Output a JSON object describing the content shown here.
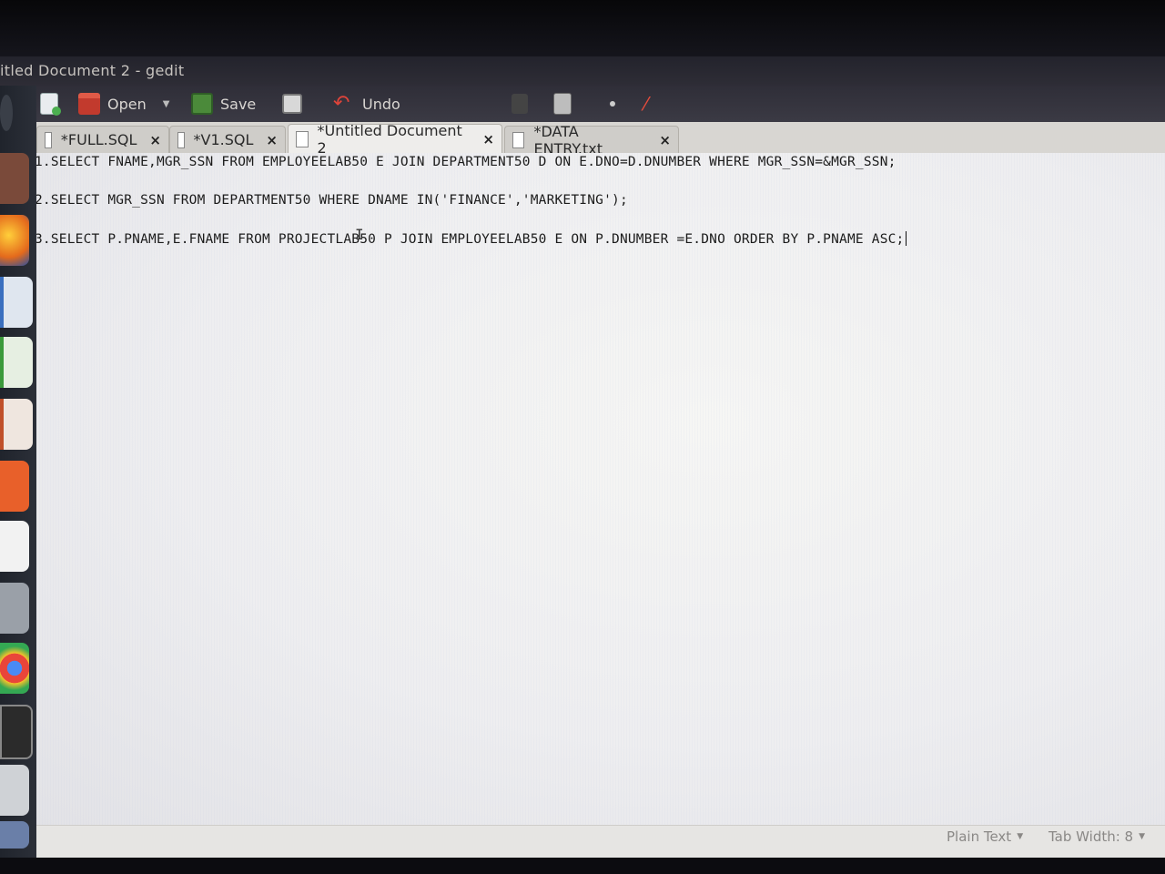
{
  "window": {
    "title": "itled Document 2 - gedit"
  },
  "toolbar": {
    "open_label": "Open",
    "save_label": "Save",
    "undo_label": "Undo",
    "icons": [
      "new-document-icon",
      "open-icon",
      "save-icon",
      "print-icon",
      "undo-icon",
      "cut-icon",
      "copy-icon",
      "paste-icon",
      "find-replace-icon"
    ]
  },
  "launcher": {
    "icons": [
      "ubuntu-dash-icon",
      "files-icon",
      "firefox-icon",
      "writer-icon",
      "calc-icon",
      "impress-icon",
      "software-center-icon",
      "amazon-icon",
      "settings-icon",
      "chrome-icon",
      "terminal-icon",
      "text-editor-icon",
      "workspace-icon"
    ]
  },
  "tabs": [
    {
      "label": "*FULL.SQL",
      "active": false
    },
    {
      "label": "*V1.SQL",
      "active": false
    },
    {
      "label": "*Untitled Document 2",
      "active": true
    },
    {
      "label": "*DATA ENTRY.txt",
      "active": false
    }
  ],
  "tab_close_symbol": "×",
  "editor": {
    "lines": [
      "1.SELECT FNAME,MGR_SSN FROM EMPLOYEELAB50 E JOIN DEPARTMENT50 D ON E.DNO=D.DNUMBER WHERE MGR_SSN=&MGR_SSN;",
      "",
      "2.SELECT MGR_SSN FROM DEPARTMENT50 WHERE DNAME IN('FINANCE','MARKETING');",
      "",
      "3.SELECT P.PNAME,E.FNAME FROM PROJECTLAB50 P JOIN EMPLOYEELAB50 E ON P.DNUMBER =E.DNO ORDER BY P.PNAME ASC;"
    ]
  },
  "statusbar": {
    "language": "Plain Text",
    "tab_width": "Tab Width: 8"
  }
}
